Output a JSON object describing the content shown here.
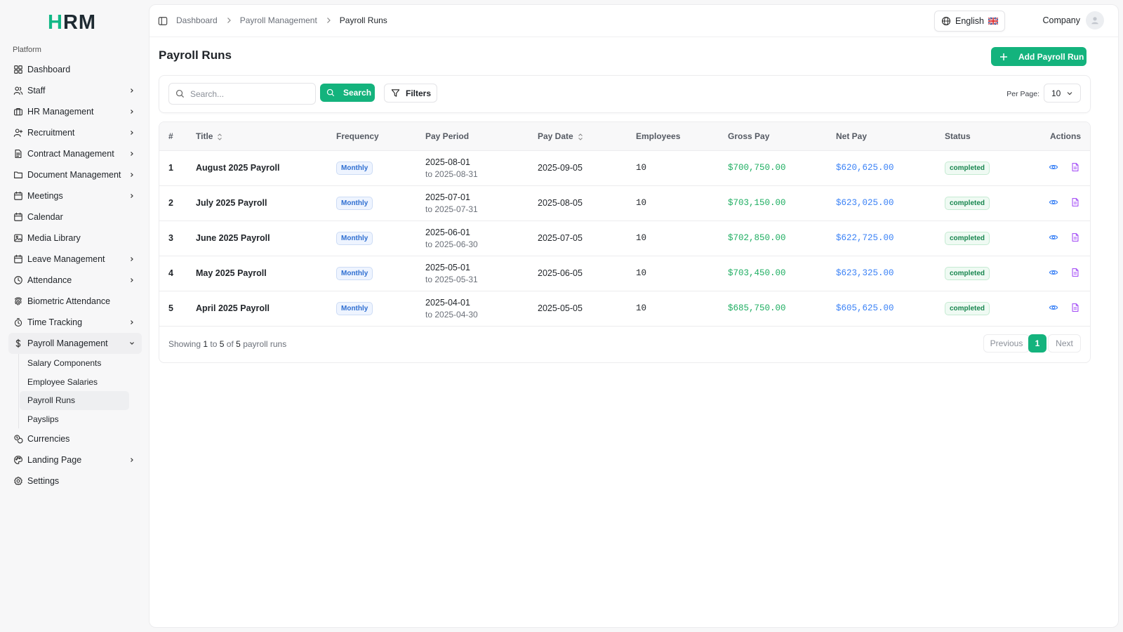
{
  "app": {
    "logo_text_a": "H",
    "logo_text_b": "RM"
  },
  "sidebar": {
    "section_label": "Platform",
    "items": [
      {
        "label": "Dashboard",
        "icon": "grid-icon",
        "chevron": false
      },
      {
        "label": "Staff",
        "icon": "users-icon",
        "chevron": true
      },
      {
        "label": "HR Management",
        "icon": "briefcase-icon",
        "chevron": true
      },
      {
        "label": "Recruitment",
        "icon": "user-plus-icon",
        "chevron": true
      },
      {
        "label": "Contract Management",
        "icon": "file-contract-icon",
        "chevron": true
      },
      {
        "label": "Document Management",
        "icon": "folder-icon",
        "chevron": true
      },
      {
        "label": "Meetings",
        "icon": "calendar-icon",
        "chevron": true
      },
      {
        "label": "Calendar",
        "icon": "calendar-icon",
        "chevron": false
      },
      {
        "label": "Media Library",
        "icon": "image-icon",
        "chevron": false
      },
      {
        "label": "Leave Management",
        "icon": "calendar-icon",
        "chevron": true
      },
      {
        "label": "Attendance",
        "icon": "clock-icon",
        "chevron": true
      },
      {
        "label": "Biometric Attendance",
        "icon": "fingerprint-icon",
        "chevron": false
      },
      {
        "label": "Time Tracking",
        "icon": "timer-icon",
        "chevron": true
      },
      {
        "label": "Payroll Management",
        "icon": "dollar-icon",
        "chevron": true,
        "expanded": true
      },
      {
        "label": "Currencies",
        "icon": "coins-icon",
        "chevron": false
      },
      {
        "label": "Landing Page",
        "icon": "palette-icon",
        "chevron": true
      },
      {
        "label": "Settings",
        "icon": "gear-icon",
        "chevron": false
      }
    ],
    "payroll_sub": [
      "Salary Components",
      "Employee Salaries",
      "Payroll Runs",
      "Payslips"
    ]
  },
  "header": {
    "breadcrumbs": [
      "Dashboard",
      "Payroll Management",
      "Payroll Runs"
    ],
    "language": "English",
    "company": "Company"
  },
  "page": {
    "title": "Payroll Runs",
    "add_button": "Add Payroll Run"
  },
  "filters": {
    "search_placeholder": "Search...",
    "search_button": "Search",
    "filters_button": "Filters",
    "per_page_label": "Per Page:",
    "per_page_value": "10"
  },
  "table": {
    "columns": [
      "#",
      "Title",
      "Frequency",
      "Pay Period",
      "Pay Date",
      "Employees",
      "Gross Pay",
      "Net Pay",
      "Status",
      "Actions"
    ],
    "rows": [
      {
        "num": "1",
        "title": "August 2025 Payroll",
        "frequency": "Monthly",
        "period_from": "2025-08-01",
        "period_to": "to 2025-08-31",
        "pay_date": "2025-09-05",
        "employees": "10",
        "gross": "$700,750.00",
        "net": "$620,625.00",
        "status": "completed"
      },
      {
        "num": "2",
        "title": "July 2025 Payroll",
        "frequency": "Monthly",
        "period_from": "2025-07-01",
        "period_to": "to 2025-07-31",
        "pay_date": "2025-08-05",
        "employees": "10",
        "gross": "$703,150.00",
        "net": "$623,025.00",
        "status": "completed"
      },
      {
        "num": "3",
        "title": "June 2025 Payroll",
        "frequency": "Monthly",
        "period_from": "2025-06-01",
        "period_to": "to 2025-06-30",
        "pay_date": "2025-07-05",
        "employees": "10",
        "gross": "$702,850.00",
        "net": "$622,725.00",
        "status": "completed"
      },
      {
        "num": "4",
        "title": "May 2025 Payroll",
        "frequency": "Monthly",
        "period_from": "2025-05-01",
        "period_to": "to 2025-05-31",
        "pay_date": "2025-06-05",
        "employees": "10",
        "gross": "$703,450.00",
        "net": "$623,325.00",
        "status": "completed"
      },
      {
        "num": "5",
        "title": "April 2025 Payroll",
        "frequency": "Monthly",
        "period_from": "2025-04-01",
        "period_to": "to 2025-04-30",
        "pay_date": "2025-05-05",
        "employees": "10",
        "gross": "$685,750.00",
        "net": "$605,625.00",
        "status": "completed"
      }
    ]
  },
  "pagination": {
    "showing_prefix": "Showing",
    "showing_from": "1",
    "showing_to_word": "to",
    "showing_to": "5",
    "showing_of_word": "of",
    "showing_total": "5",
    "showing_suffix": "payroll runs",
    "previous": "Previous",
    "current_page": "1",
    "next": "Next"
  },
  "colors": {
    "accent": "#14b37d",
    "gross": "#1fae62",
    "net": "#3b82f6",
    "actions_view": "#3b82f6",
    "actions_doc": "#a855f7"
  }
}
